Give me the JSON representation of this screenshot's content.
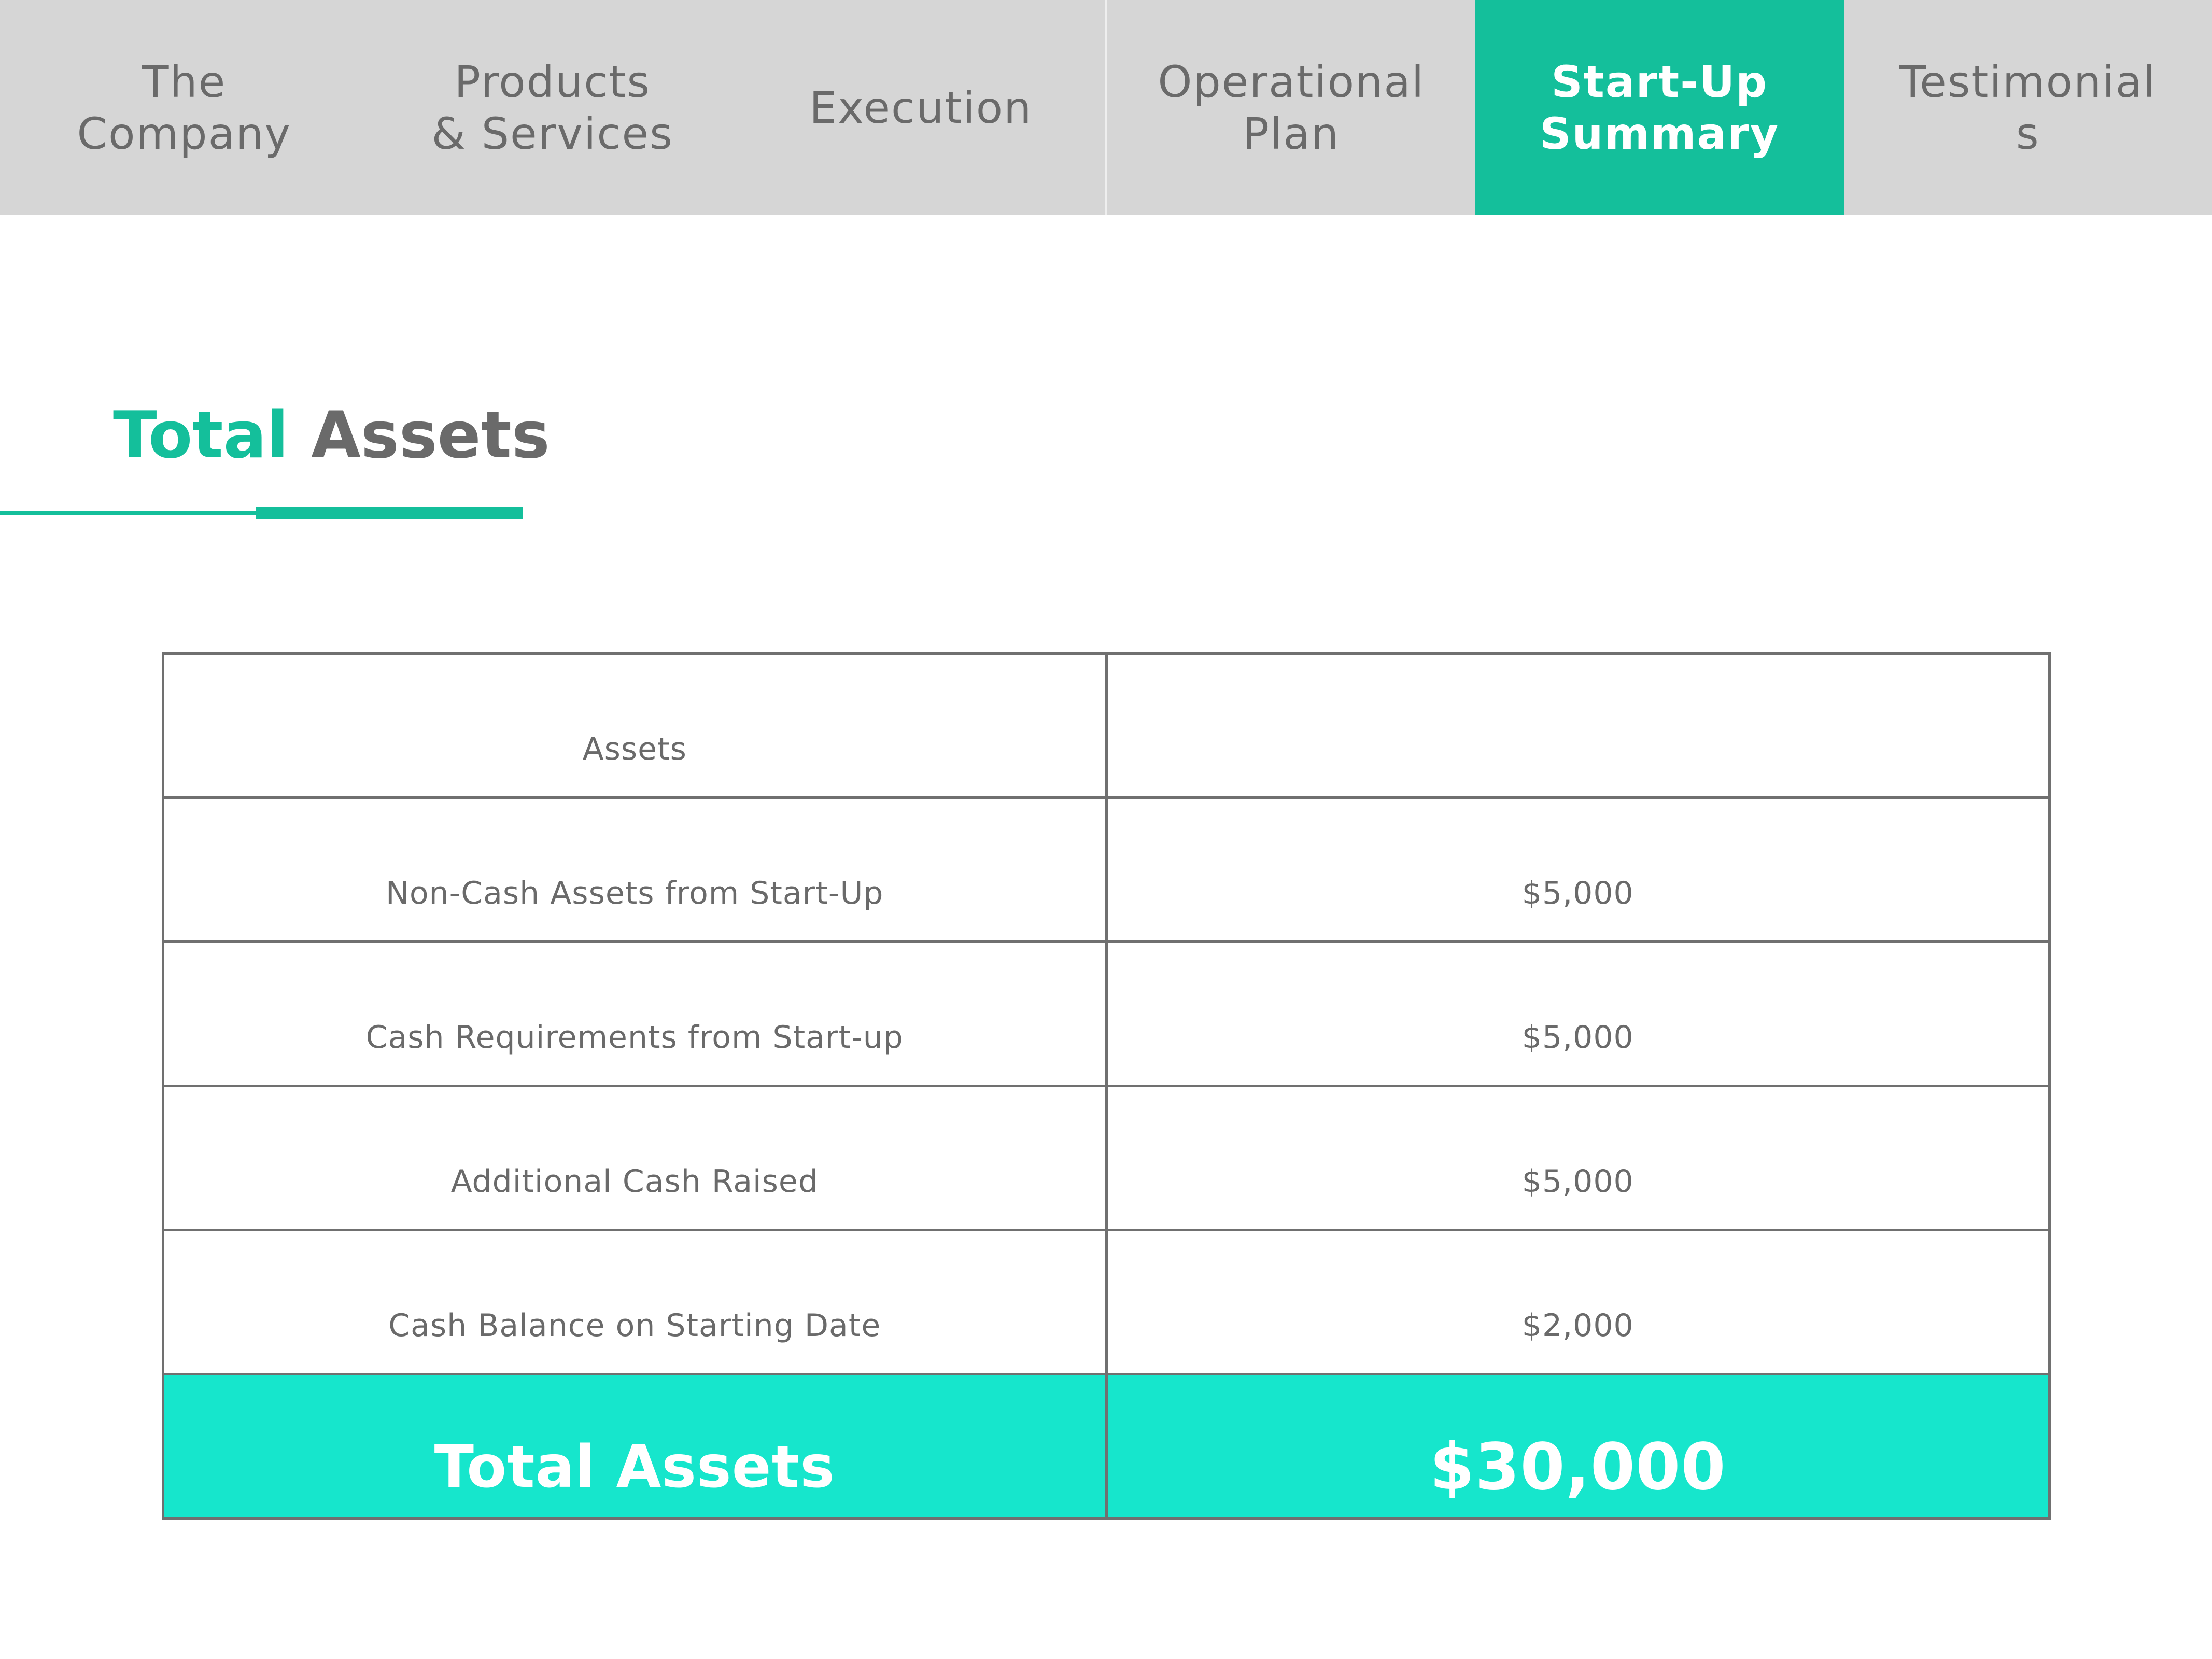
{
  "nav": {
    "tabs": [
      {
        "label": "The\nCompany",
        "active": false
      },
      {
        "label": "Products\n& Services",
        "active": false
      },
      {
        "label": "Execution",
        "active": false
      },
      {
        "label": "Operational\nPlan",
        "active": false
      },
      {
        "label": "Start-Up\nSummary",
        "active": true
      },
      {
        "label": "Testimonial\ns",
        "active": false
      }
    ]
  },
  "heading": {
    "accent": "Total",
    "rest": "Assets"
  },
  "table": {
    "header": {
      "label": "Assets",
      "value": ""
    },
    "rows": [
      {
        "label": "Non-Cash Assets from Start-Up",
        "value": "$5,000"
      },
      {
        "label": "Cash Requirements from Start-up",
        "value": "$5,000"
      },
      {
        "label": "Additional Cash Raised",
        "value": "$5,000"
      },
      {
        "label": "Cash Balance on Starting Date",
        "value": "$2,000"
      }
    ],
    "total": {
      "label": "Total Assets",
      "value": "$30,000"
    }
  },
  "colors": {
    "accent": "#14bf9b",
    "total_row": "#16e6cc",
    "nav_bg": "#d6d6d6",
    "text_gray": "#6a6a6a"
  }
}
